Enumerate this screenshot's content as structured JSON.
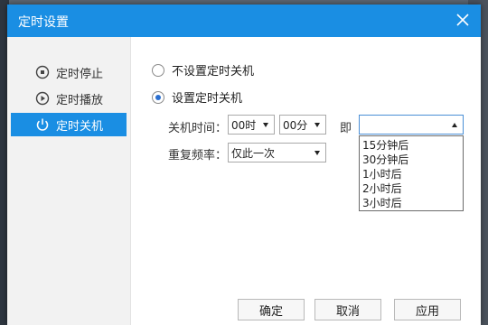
{
  "window": {
    "title": "定时设置"
  },
  "sidebar": {
    "items": [
      {
        "label": "定时停止",
        "icon": "clock-stop-icon"
      },
      {
        "label": "定时播放",
        "icon": "clock-play-icon"
      },
      {
        "label": "定时关机",
        "icon": "power-icon",
        "active": true
      }
    ]
  },
  "options": {
    "no_shutdown": "不设置定时关机",
    "set_shutdown": "设置定时关机",
    "selected": "set_shutdown"
  },
  "shutdown_time": {
    "label": "关机时间：",
    "hour": "00时",
    "minute": "00分",
    "connector": "即",
    "quick_value": ""
  },
  "repeat": {
    "label": "重复频率：",
    "value": "仅此一次"
  },
  "quick_options": [
    "15分钟后",
    "30分钟后",
    "1小时后",
    "2小时后",
    "3小时后"
  ],
  "buttons": {
    "ok": "确定",
    "cancel": "取消",
    "apply": "应用"
  },
  "colors": {
    "accent": "#1a8ee3"
  }
}
